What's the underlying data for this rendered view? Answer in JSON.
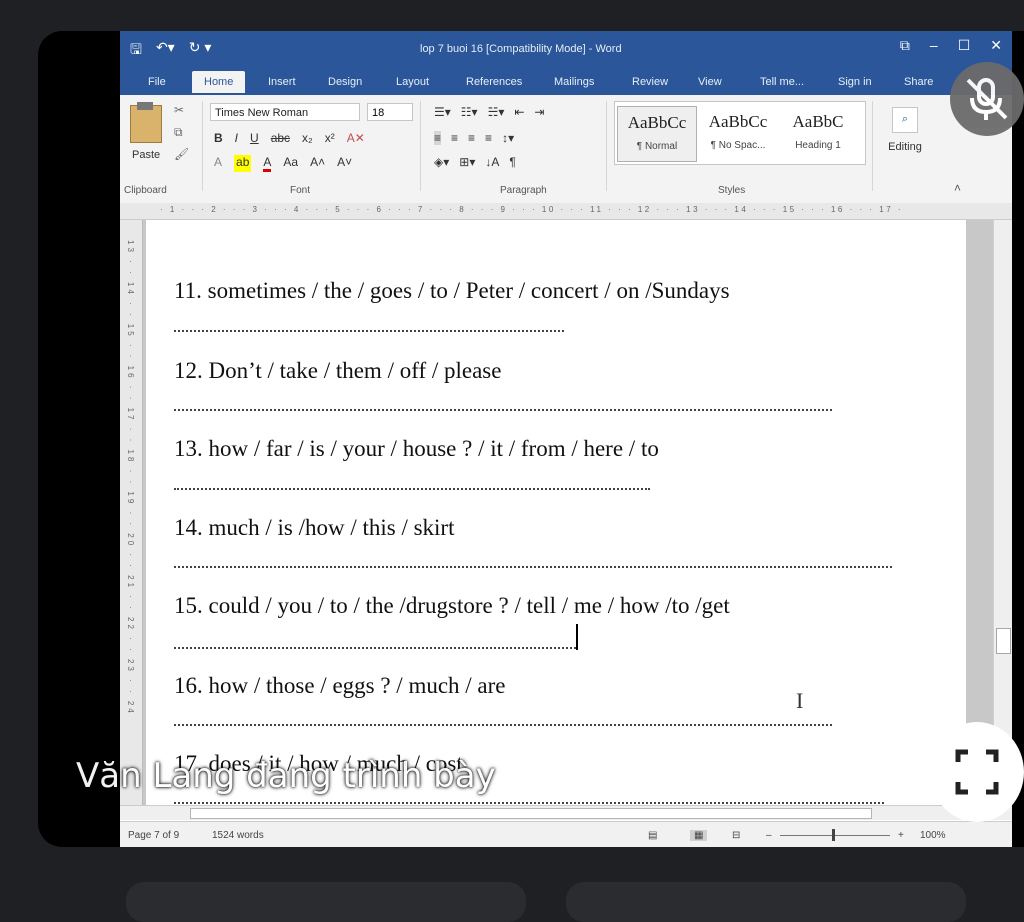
{
  "word": {
    "title": "lop 7 buoi 16 [Compatibility Mode] - Word",
    "qat": {
      "save_icon": "save-icon",
      "undo_icon": "undo-icon",
      "redo_icon": "redo-icon"
    },
    "tabs": [
      "File",
      "Home",
      "Insert",
      "Design",
      "Layout",
      "References",
      "Mailings",
      "Review",
      "View",
      "Tell me...",
      "Sign in",
      "Share"
    ],
    "active_tab": "Home",
    "ribbon": {
      "clipboard": {
        "paste_label": "Paste",
        "group_label": "Clipboard"
      },
      "font": {
        "name": "Times New Roman",
        "size": "18",
        "group_label": "Font"
      },
      "paragraph": {
        "group_label": "Paragraph"
      },
      "styles": {
        "group_label": "Styles",
        "items": [
          {
            "sample": "AaBbCc",
            "name": "¶ Normal"
          },
          {
            "sample": "AaBbCc",
            "name": "¶ No Spac..."
          },
          {
            "sample": "AaBbC",
            "name": "Heading 1"
          }
        ]
      },
      "editing_label": "Editing"
    },
    "ruler_text": "· 1 · · · 2 · · · 3 · · · 4 · · · 5 · · · 6 · · · 7 · · · 8 · · · 9 · · · 10 · · · 11 · · · 12 · · · 13 · · · 14 · · · 15 · · · 16 · · · 17 ·",
    "vruler_text": "13 · · 14 · · 15 · · 16 · · 17 · · 18 · · 19 · · 20 · · 21 · · 22 · · 23 · · 24",
    "document": {
      "items": [
        "11. sometimes / the / goes / to / Peter / concert / on /Sundays",
        "12. Don’t / take / them / off / please",
        "13. how / far / is / your / house ? / it / from / here / to",
        "14. much / is /how / this / skirt",
        "15. could / you / to / the /drugstore ? / tell / me / how /to /get",
        "16. how / those / eggs ? / much / are",
        "17. does / it / how / much / cost"
      ]
    },
    "status": {
      "page": "Page 7 of 9",
      "words": "1524 words",
      "zoom": "100%"
    }
  },
  "overlay": {
    "presenter": "Văn Lang đang trình bày",
    "mic_icon": "mic-off-icon",
    "fullscreen_icon": "fullscreen-icon"
  }
}
